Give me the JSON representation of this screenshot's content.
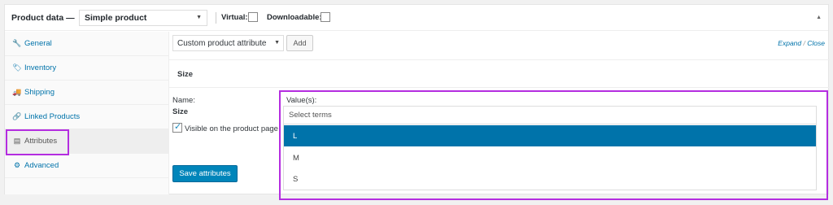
{
  "header": {
    "title": "Product data —",
    "product_type": "Simple product",
    "virtual_label": "Virtual:",
    "downloadable_label": "Downloadable:",
    "virtual_checked": false,
    "downloadable_checked": false
  },
  "sidebar": {
    "items": [
      {
        "label": "General",
        "icon": "wrench-icon",
        "glyph": "🔧",
        "active": false
      },
      {
        "label": "Inventory",
        "icon": "tag-icon",
        "glyph": "🏷",
        "active": false
      },
      {
        "label": "Shipping",
        "icon": "truck-icon",
        "glyph": "🚚",
        "active": false
      },
      {
        "label": "Linked Products",
        "icon": "link-icon",
        "glyph": "🔗",
        "active": false
      },
      {
        "label": "Attributes",
        "icon": "list-icon",
        "glyph": "▤",
        "active": true
      },
      {
        "label": "Advanced",
        "icon": "gear-icon",
        "glyph": "⚙",
        "active": false
      }
    ]
  },
  "attributes": {
    "attribute_select": "Custom product attribute",
    "add_label": "Add",
    "expand_label": "Expand",
    "separator": "/",
    "close_label": "Close",
    "attribute_name_heading": "Size",
    "name_label": "Name:",
    "name_value": "Size",
    "visible_label": "Visible on the product page",
    "visible_checked": true,
    "values_label": "Value(s):",
    "values_placeholder": "Select terms",
    "options": [
      "L",
      "M",
      "S"
    ],
    "highlighted_option": "L",
    "save_label": "Save attributes",
    "truncated_tail": "e"
  },
  "colors": {
    "link": "#0073aa",
    "primary_button": "#0085ba",
    "highlight_option": "#0073aa",
    "annotation_box": "#b42de0"
  }
}
